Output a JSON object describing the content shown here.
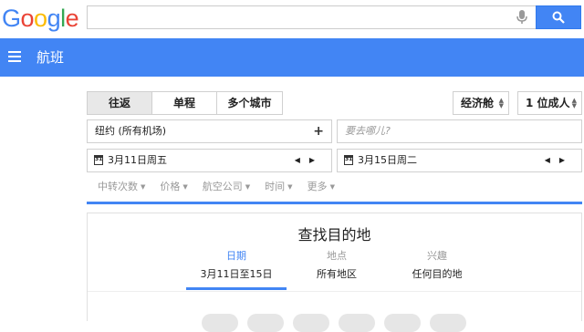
{
  "logo": [
    "G",
    "o",
    "o",
    "g",
    "l",
    "e"
  ],
  "search": {
    "value": "",
    "placeholder": ""
  },
  "section_title": "航班",
  "trip_types": [
    {
      "label": "往返",
      "active": true
    },
    {
      "label": "单程",
      "active": false
    },
    {
      "label": "多个城市",
      "active": false
    }
  ],
  "cabin_class": "经济舱",
  "passengers": "1 位成人",
  "origin": "纽约 (所有机场)",
  "destination_placeholder": "要去哪儿?",
  "depart_date": "3月11日周五",
  "return_date": "3月15日周二",
  "calendar_icon_text": "31",
  "filters": [
    "中转次数",
    "价格",
    "航空公司",
    "时间",
    "更多"
  ],
  "explore": {
    "title": "查找目的地",
    "tabs": [
      {
        "label": "日期",
        "value": "3月11日至15日",
        "active": true
      },
      {
        "label": "地点",
        "value": "所有地区",
        "active": false
      },
      {
        "label": "兴趣",
        "value": "任何目的地",
        "active": false
      }
    ]
  },
  "colors": {
    "accent": "#4285f4"
  }
}
